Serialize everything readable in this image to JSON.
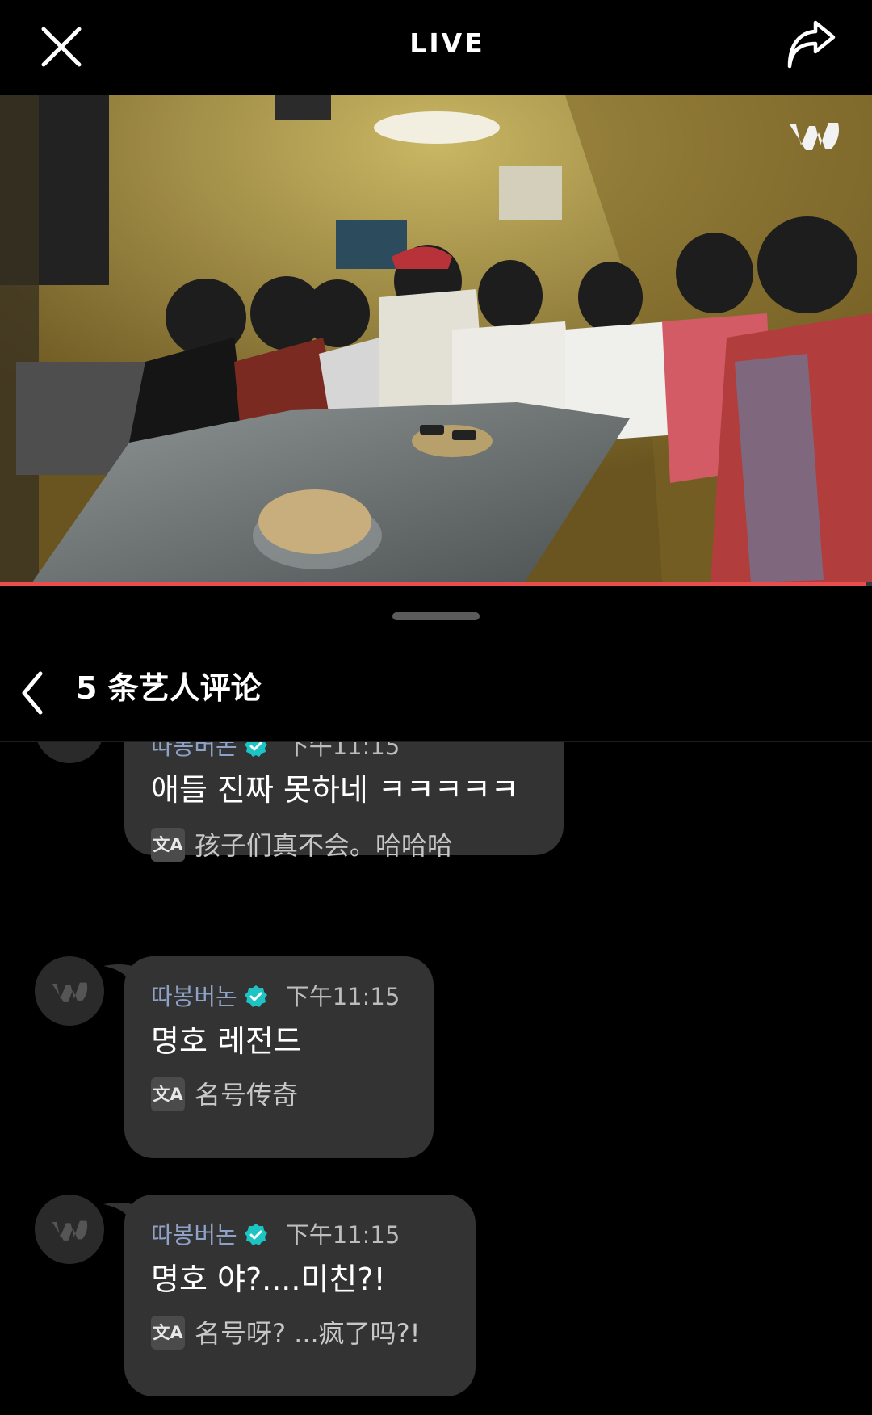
{
  "header": {
    "title": "LIVE",
    "close_icon": "close-icon",
    "share_icon": "share-icon"
  },
  "video": {
    "watermark": "weverse-logo",
    "progress": 0.993,
    "accent_color": "#ea4d4d"
  },
  "sheet": {
    "back_icon": "chevron-left-icon",
    "title": "5 条艺人评论"
  },
  "comments": [
    {
      "author": "따봉버논",
      "verified": true,
      "time": "下午11:15",
      "text": "애들 진짜 못하네 ㅋㅋㅋㅋㅋ",
      "translation": "孩子们真不会。哈哈哈"
    },
    {
      "author": "따봉버논",
      "verified": true,
      "time": "下午11:15",
      "text": "명호 레전드",
      "translation": "名号传奇"
    },
    {
      "author": "따봉버논",
      "verified": true,
      "time": "下午11:15",
      "text": "명호 야?....미친?!",
      "translation": "名号呀? ...疯了吗?!"
    }
  ],
  "colors": {
    "background": "#000000",
    "bubble": "#333333",
    "author": "#8da2c6",
    "verified_badge": "#1ec4c4",
    "progress": "#ea4d4d"
  },
  "translate_icon_label": "文A"
}
